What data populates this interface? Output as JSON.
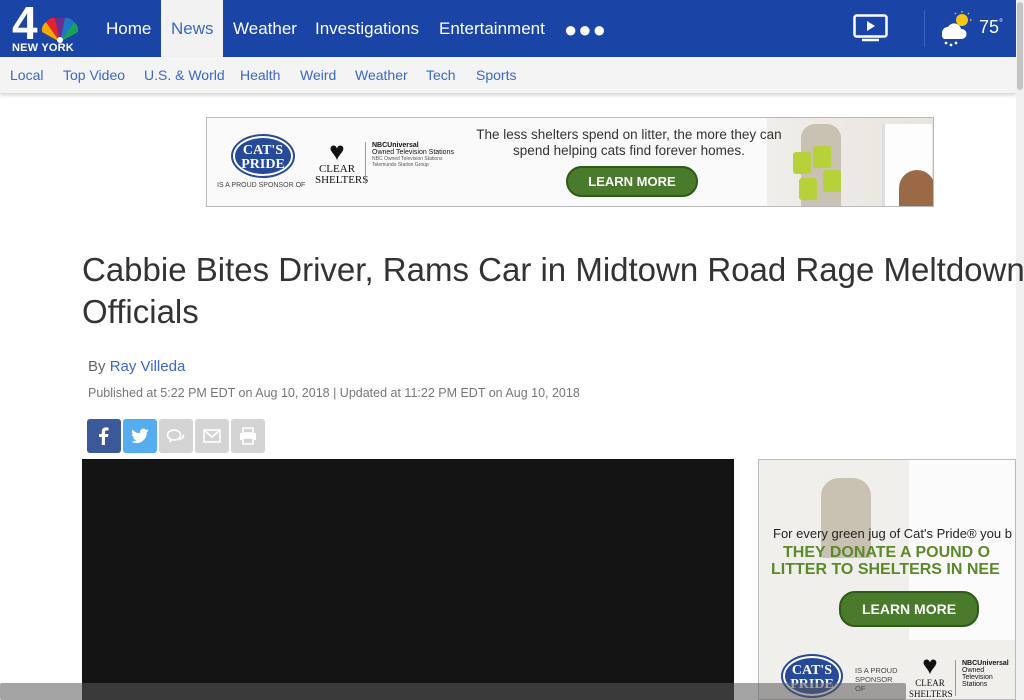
{
  "site": {
    "logo_number": "4",
    "logo_city": "NEW YORK"
  },
  "topnav": {
    "items": [
      {
        "label": "Home",
        "active": false
      },
      {
        "label": "News",
        "active": true
      },
      {
        "label": "Weather",
        "active": false
      },
      {
        "label": "Investigations",
        "active": false
      },
      {
        "label": "Entertainment",
        "active": false
      }
    ],
    "more_icon": "ellipsis-icon",
    "video_icon": "play-video-icon",
    "weather_icon": "partly-cloudy-rain-icon",
    "temperature": "75",
    "temperature_unit": "°"
  },
  "subnav": {
    "items": [
      "Local",
      "Top Video",
      "U.S. & World",
      "Health",
      "Weird",
      "Weather",
      "Tech",
      "Sports"
    ]
  },
  "ad_top": {
    "brand": "CAT'S PRIDE",
    "sponsor_text": "IS A PROUD SPONSOR OF",
    "clear_logo_line1": "CLEAR",
    "clear_logo_line2": "SHELTERS",
    "nbc_line1": "NBCUniversal",
    "nbc_line2": "Owned Television Stations",
    "nbc_line3": "NBC Owned Television Stations",
    "nbc_line4": "Telemundo Station Group",
    "tagline": "The less shelters spend on litter, the more they can spend helping cats find forever homes.",
    "button": "LEARN MORE"
  },
  "article": {
    "headline": "Cabbie Bites Driver, Rams Car in Midtown Road Rage Meltdown: Officials",
    "by_prefix": "By",
    "author": "Ray Villeda",
    "published": "Published at 5:22 PM EDT on Aug 10, 2018 | Updated at 11:22 PM EDT on Aug 10, 2018"
  },
  "share": {
    "buttons": [
      {
        "icon": "facebook-icon",
        "color": "#3b5998"
      },
      {
        "icon": "twitter-icon",
        "color": "#55acee"
      },
      {
        "icon": "comment-icon",
        "color": "#d0d0d0"
      },
      {
        "icon": "email-icon",
        "color": "#d0d0d0"
      },
      {
        "icon": "print-icon",
        "color": "#d0d0d0"
      }
    ]
  },
  "ad_right": {
    "line1": "For every green jug of Cat's Pride® you b",
    "line2a": "THEY DONATE A POUND O",
    "line2b": "LITTER TO SHELTERS IN NEE",
    "button": "LEARN MORE",
    "brand": "CAT'S PRIDE",
    "sponsor_text": "IS A PROUD SPONSOR OF",
    "clear_logo_line1": "CLEAR",
    "clear_logo_line2": "SHELTERS",
    "nbc_line1": "NBCUniversal",
    "nbc_line2": "Owned Television Stations"
  },
  "colors": {
    "nav_blue": "#1a44a6",
    "link_blue": "#3a68c8",
    "ad_green": "#4a7a2c"
  }
}
